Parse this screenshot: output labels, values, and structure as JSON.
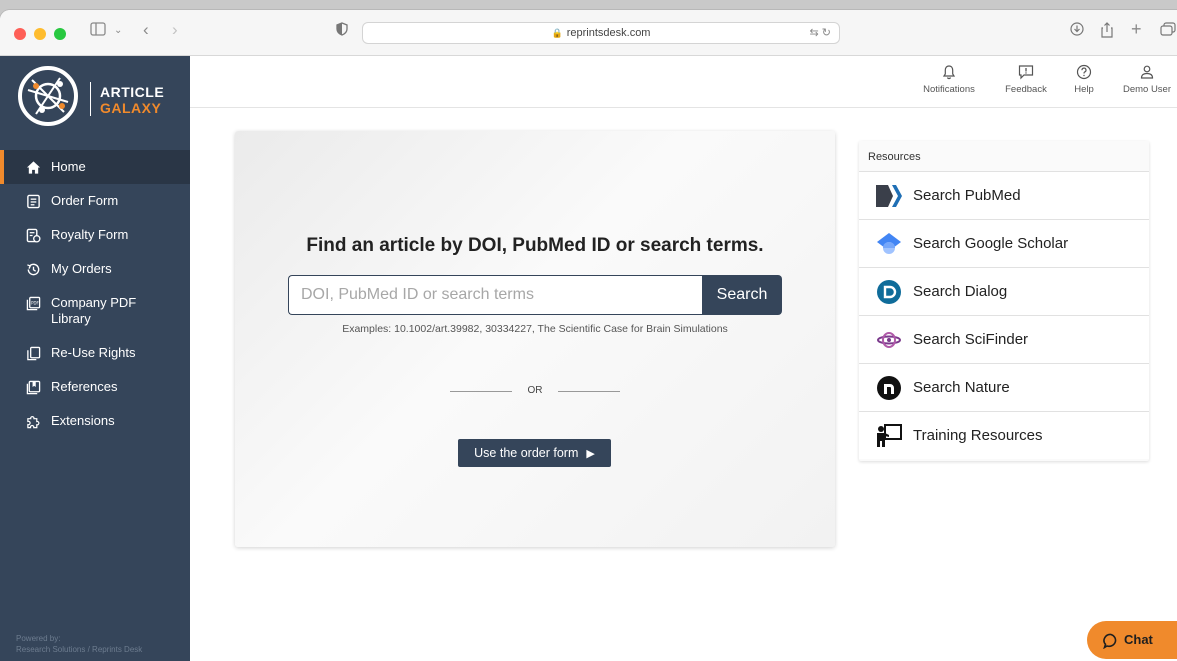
{
  "browser": {
    "url": "reprintsdesk.com"
  },
  "logo": {
    "line1": "ARTICLE",
    "line2": "GALAXY"
  },
  "sidebar": {
    "items": [
      {
        "label": "Home",
        "icon": "home-icon",
        "active": true
      },
      {
        "label": "Order Form",
        "icon": "order-form-icon"
      },
      {
        "label": "Royalty Form",
        "icon": "royalty-form-icon"
      },
      {
        "label": "My Orders",
        "icon": "history-icon"
      },
      {
        "label": "Company PDF\nLibrary",
        "icon": "pdf-library-icon"
      },
      {
        "label": "Re-Use Rights",
        "icon": "copy-icon"
      },
      {
        "label": "References",
        "icon": "bookmark-icon"
      },
      {
        "label": "Extensions",
        "icon": "puzzle-icon"
      }
    ],
    "powered_line1": "Powered by:",
    "powered_line2": "Research Solutions / Reprints Desk"
  },
  "header": {
    "notifications": "Notifications",
    "feedback": "Feedback",
    "help": "Help",
    "user": "Demo User"
  },
  "main": {
    "title": "Find an article by DOI, PubMed ID or search terms.",
    "search_placeholder": "DOI, PubMed ID or search terms",
    "search_button": "Search",
    "examples": "Examples: 10.1002/art.39982, 30334227, The Scientific Case for Brain Simulations",
    "or": "OR",
    "order_button": "Use the order form"
  },
  "resources": {
    "heading": "Resources",
    "items": [
      {
        "label": "Search PubMed",
        "icon": "pubmed-icon"
      },
      {
        "label": "Search Google Scholar",
        "icon": "google-scholar-icon"
      },
      {
        "label": "Search Dialog",
        "icon": "dialog-icon"
      },
      {
        "label": "Search SciFinder",
        "icon": "scifinder-icon"
      },
      {
        "label": "Search Nature",
        "icon": "nature-icon"
      },
      {
        "label": "Training Resources",
        "icon": "training-icon"
      }
    ]
  },
  "chat": {
    "label": "Chat"
  },
  "colors": {
    "sidebar": "#35455a",
    "accent": "#f08a2c"
  }
}
